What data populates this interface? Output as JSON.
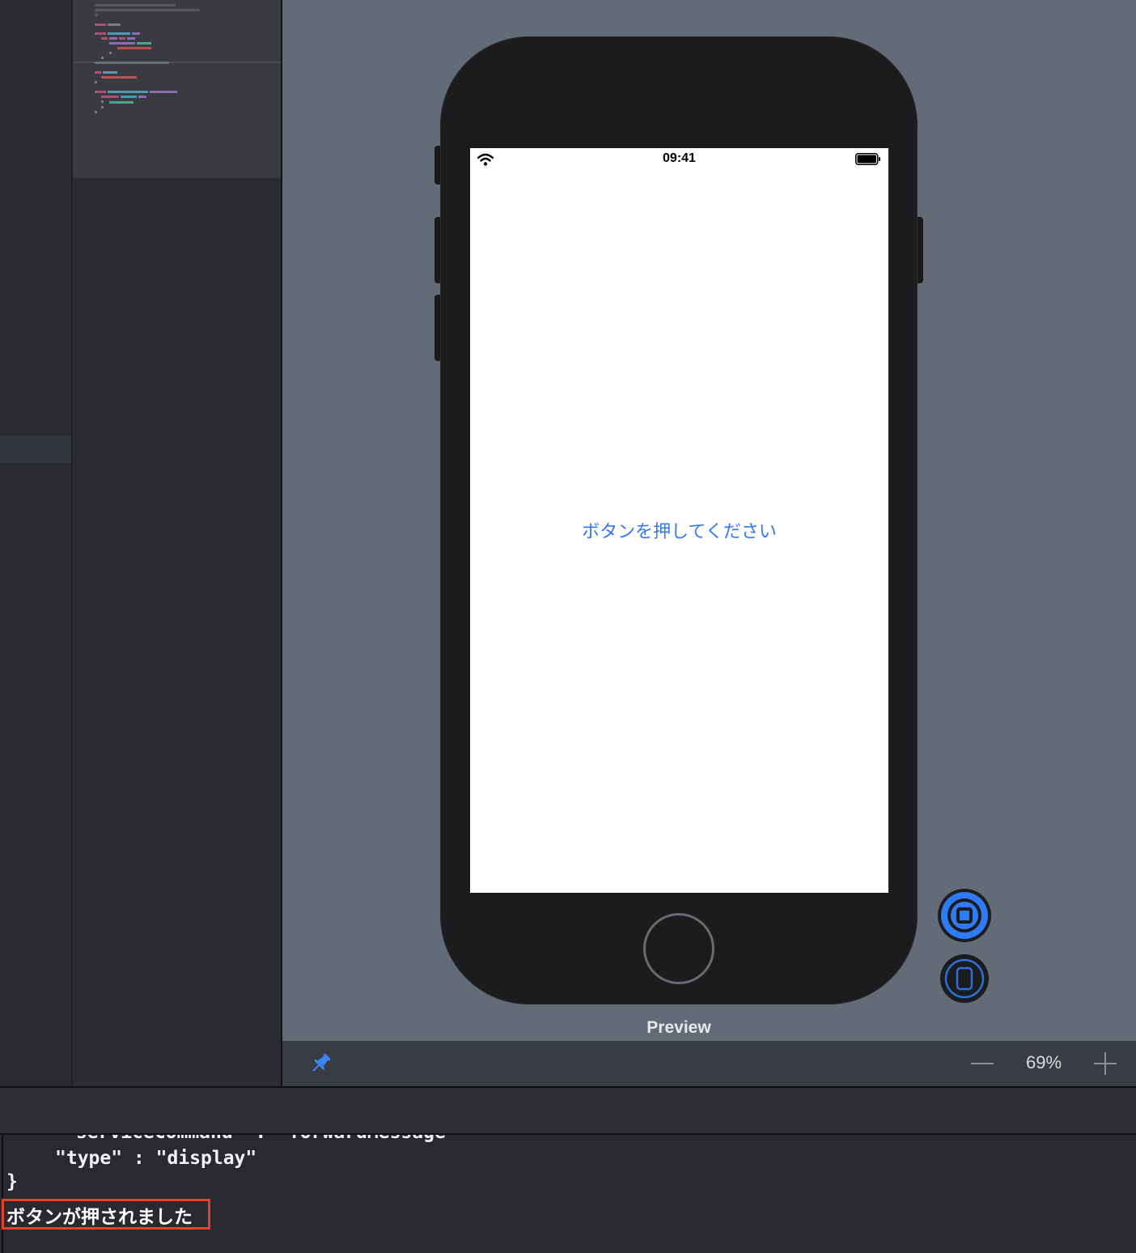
{
  "canvas": {
    "preview_label": "Preview",
    "zoom_level": "69%"
  },
  "device": {
    "status_time": "09:41",
    "button_label": "ボタンを押してください"
  },
  "console": {
    "lines": {
      "clipped": "\"serviceCommand\" : \"forwardMessage\"",
      "type_line": "\"type\" : \"display\"",
      "close_brace": "}"
    },
    "message": "ボタンが押されました"
  },
  "colors": {
    "accent": "#3478f6",
    "highlight_border": "#e2432a",
    "canvas_bg": "#636b76",
    "phone_body": "#1c1c1e"
  },
  "icons": {
    "pin": "pin-icon",
    "live": "live-preview-icon",
    "device": "device-preview-icon",
    "wifi": "wifi-icon",
    "battery": "battery-icon",
    "zoom_out": "minus-icon",
    "zoom_in": "plus-icon"
  }
}
